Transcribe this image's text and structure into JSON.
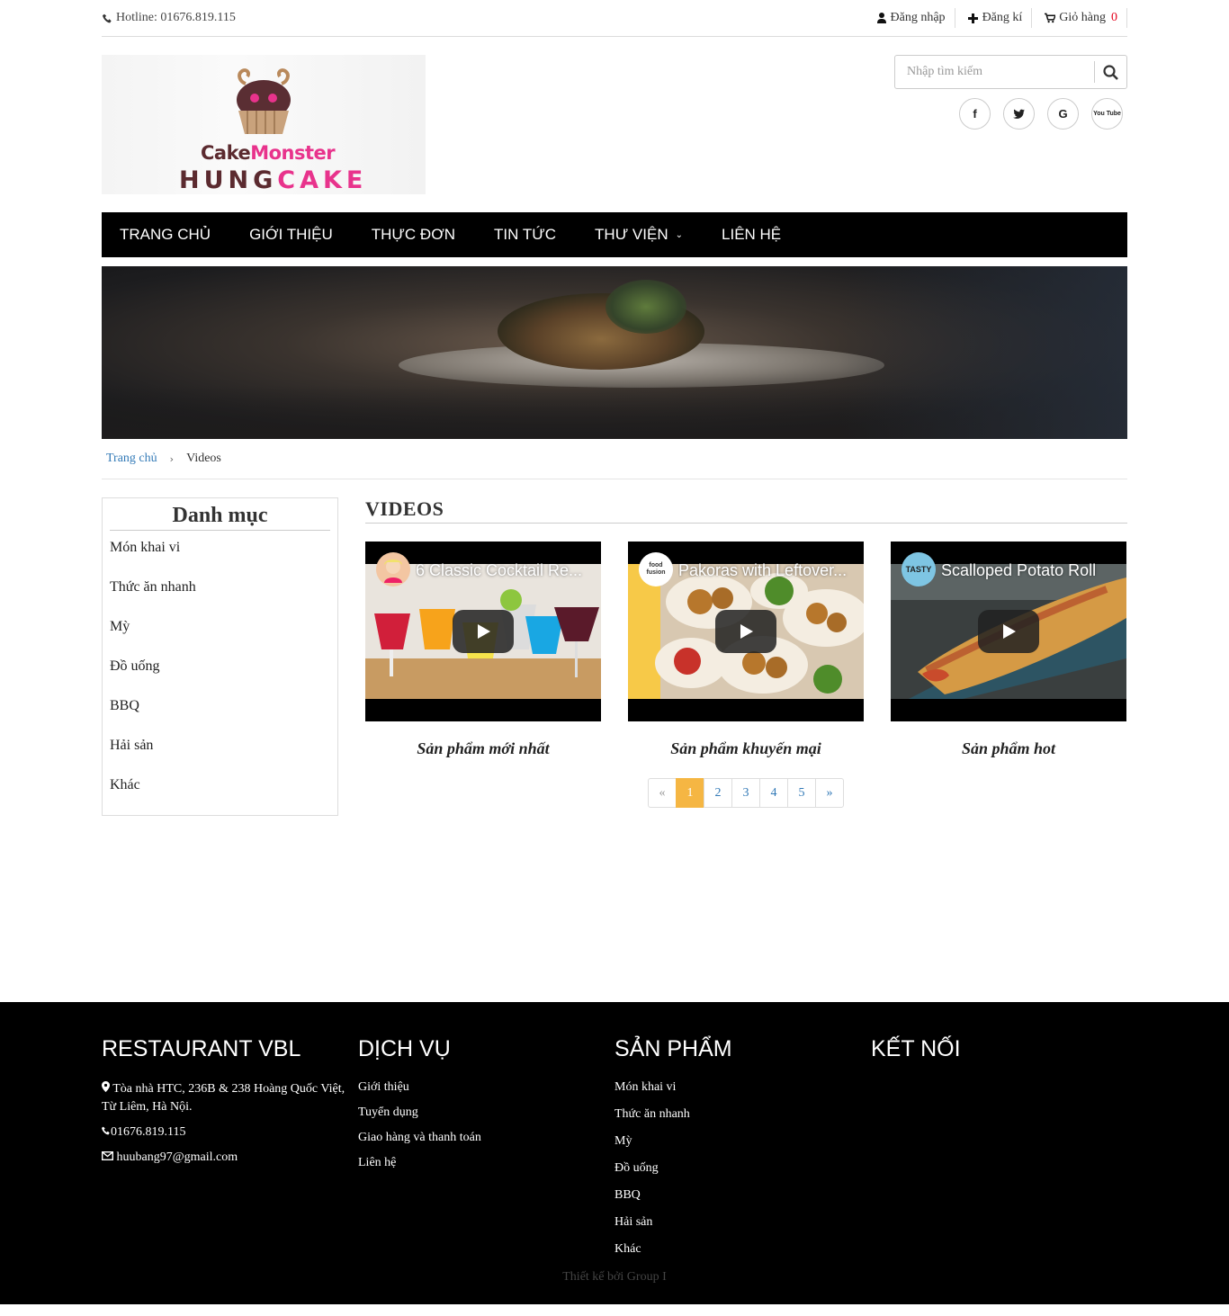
{
  "topbar": {
    "hotline": "Hotline: 01676.819.115",
    "login": "Đăng nhập",
    "register": "Đăng kí",
    "cart_label": "Giỏ hàng",
    "cart_count": "0"
  },
  "logo": {
    "brand_line1_a": "Cake",
    "brand_line1_b": "Monster",
    "brand_line2_a": "HUNG",
    "brand_line2_b": "CAKE"
  },
  "search": {
    "placeholder": "Nhập tìm kiếm"
  },
  "social": [
    "f",
    "t",
    "G",
    "You Tube"
  ],
  "nav": {
    "items": [
      "TRANG CHỦ",
      "GIỚI THIỆU",
      "THỰC ĐƠN",
      "TIN TỨC",
      "THƯ VIỆN",
      "LIÊN HỆ"
    ]
  },
  "breadcrumb": {
    "home": "Trang chủ",
    "current": "Videos"
  },
  "sidebar": {
    "title": "Danh mục",
    "items": [
      "Món khai vi",
      "Thức ăn nhanh",
      "Mỳ",
      "Đồ uống",
      "BBQ",
      "Hải sản",
      "Khác"
    ]
  },
  "main": {
    "title": "VIDEOS",
    "videos": [
      {
        "title": "6 Classic Cocktail Re...",
        "channel": "",
        "caption": "Sản phẩm mới nhất"
      },
      {
        "title": "Pakoras with Leftover...",
        "channel": "food fusion",
        "caption": "Sản phẩm khuyến mại"
      },
      {
        "title": "Scalloped Potato Roll",
        "channel": "TASTY",
        "caption": "Sản phẩm hot"
      }
    ],
    "pagination": [
      "«",
      "1",
      "2",
      "3",
      "4",
      "5",
      "»"
    ],
    "active_page": "1"
  },
  "footer": {
    "col1": {
      "title": "RESTAURANT VBL",
      "address": "Tòa nhà HTC, 236B & 238 Hoàng Quốc Việt, Từ Liêm, Hà Nội.",
      "phone": "01676.819.115",
      "email": "huubang97@gmail.com"
    },
    "col2": {
      "title": "DỊCH VỤ",
      "items": [
        "Giới thiệu",
        "Tuyển dụng",
        "Giao hàng và thanh toán",
        "Liên hệ"
      ]
    },
    "col3": {
      "title": "SẢN PHẨM",
      "items": [
        "Món khai vi",
        "Thức ăn nhanh",
        "Mỳ",
        "Đồ uống",
        "BBQ",
        "Hải sản",
        "Khác"
      ]
    },
    "col4": {
      "title": "KẾT NỐI"
    },
    "copyright": "Thiết kế bởi Group I"
  },
  "colors": {
    "accent": "#f5b643",
    "link": "#337ab7",
    "cart_count": "#e4001b",
    "nav_bg": "#000000"
  }
}
